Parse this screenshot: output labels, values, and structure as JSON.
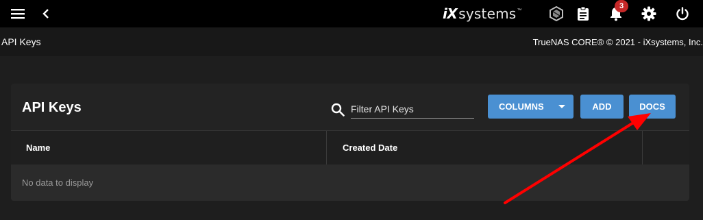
{
  "topbar": {
    "logo_ix": "iX",
    "logo_systems": "systems",
    "logo_tm": "™",
    "notification_count": "3",
    "icons": [
      "menu-icon",
      "back-icon",
      "truecommand-icon",
      "task-manager-icon",
      "bell-icon",
      "gear-icon",
      "power-icon"
    ]
  },
  "pagebar": {
    "title": "API Keys",
    "copyright": "TrueNAS CORE® © 2021 - iXsystems, Inc."
  },
  "card": {
    "title": "API Keys",
    "filter_placeholder": "Filter API Keys",
    "columns_label": "COLUMNS",
    "add_label": "ADD",
    "docs_label": "DOCS"
  },
  "table": {
    "columns": [
      "Name",
      "Created Date"
    ],
    "empty_message": "No data to display"
  },
  "colors": {
    "accent": "#4a90d2",
    "badge": "#c62828",
    "annotation": "#ff0000"
  }
}
